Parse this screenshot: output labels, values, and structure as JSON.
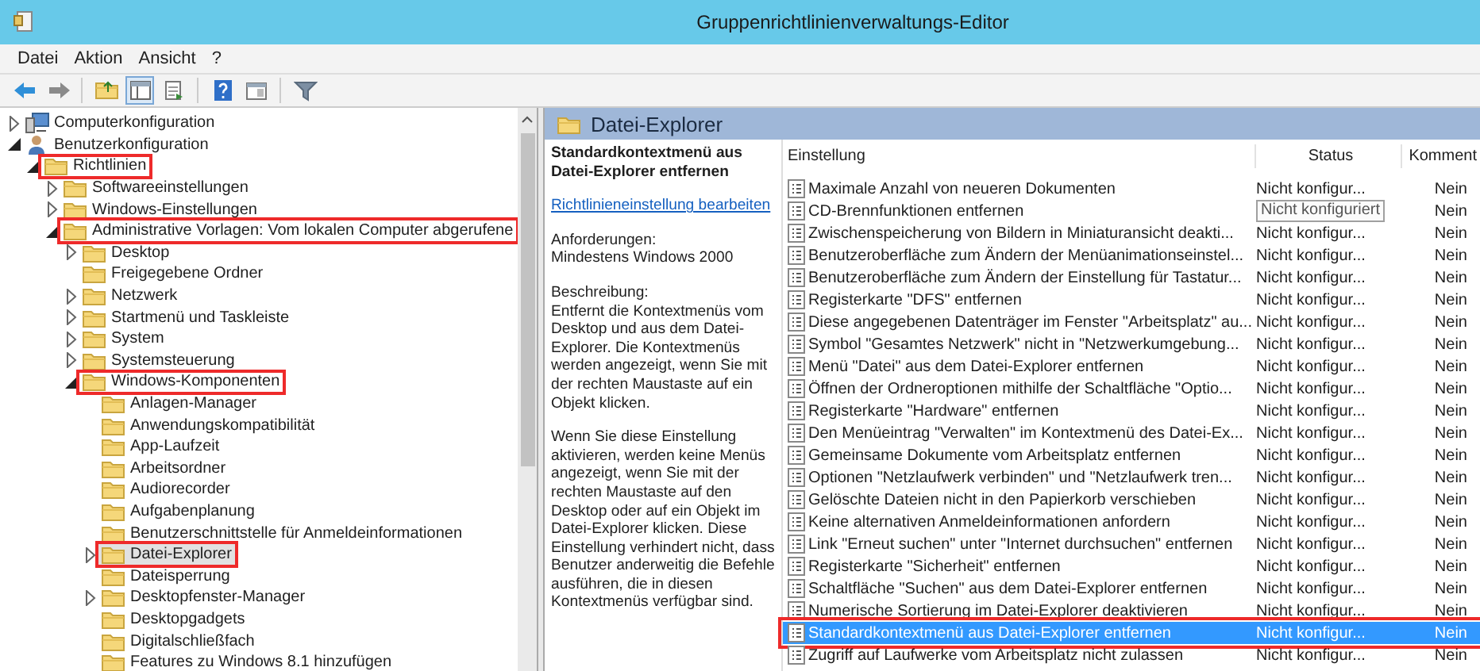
{
  "window": {
    "title": "Gruppenrichtlinienverwaltungs-Editor"
  },
  "menu": [
    "Datei",
    "Aktion",
    "Ansicht",
    "?"
  ],
  "tree": [
    {
      "label": "Computerkonfiguration",
      "kind": "computer",
      "expandable": true,
      "expanded": false,
      "selected": false,
      "highlighted": false
    },
    {
      "label": "Benutzerkonfiguration",
      "kind": "user",
      "expandable": true,
      "expanded": true,
      "selected": false,
      "highlighted": false,
      "children": [
        {
          "label": "Richtlinien",
          "kind": "folder",
          "expandable": true,
          "expanded": true,
          "selected": false,
          "highlighted": true,
          "children": [
            {
              "label": "Softwareeinstellungen",
              "kind": "folder",
              "expandable": true,
              "expanded": false,
              "selected": false,
              "highlighted": false
            },
            {
              "label": "Windows-Einstellungen",
              "kind": "folder",
              "expandable": true,
              "expanded": false,
              "selected": false,
              "highlighted": false
            },
            {
              "label": "Administrative Vorlagen: Vom lokalen Computer abgerufene",
              "kind": "folder",
              "expandable": true,
              "expanded": true,
              "selected": false,
              "highlighted": true,
              "children": [
                {
                  "label": "Desktop",
                  "kind": "folder",
                  "expandable": true,
                  "expanded": false,
                  "selected": false,
                  "highlighted": false
                },
                {
                  "label": "Freigegebene Ordner",
                  "kind": "folder",
                  "expandable": false,
                  "selected": false,
                  "highlighted": false
                },
                {
                  "label": "Netzwerk",
                  "kind": "folder",
                  "expandable": true,
                  "expanded": false,
                  "selected": false,
                  "highlighted": false
                },
                {
                  "label": "Startmenü und Taskleiste",
                  "kind": "folder",
                  "expandable": true,
                  "expanded": false,
                  "selected": false,
                  "highlighted": false
                },
                {
                  "label": "System",
                  "kind": "folder",
                  "expandable": true,
                  "expanded": false,
                  "selected": false,
                  "highlighted": false
                },
                {
                  "label": "Systemsteuerung",
                  "kind": "folder",
                  "expandable": true,
                  "expanded": false,
                  "selected": false,
                  "highlighted": false
                },
                {
                  "label": "Windows-Komponenten",
                  "kind": "folder",
                  "expandable": true,
                  "expanded": true,
                  "selected": false,
                  "highlighted": true,
                  "children": [
                    {
                      "label": "Anlagen-Manager",
                      "kind": "folder",
                      "expandable": false,
                      "selected": false,
                      "highlighted": false
                    },
                    {
                      "label": "Anwendungskompatibilität",
                      "kind": "folder",
                      "expandable": false,
                      "selected": false,
                      "highlighted": false
                    },
                    {
                      "label": "App-Laufzeit",
                      "kind": "folder",
                      "expandable": false,
                      "selected": false,
                      "highlighted": false
                    },
                    {
                      "label": "Arbeitsordner",
                      "kind": "folder",
                      "expandable": false,
                      "selected": false,
                      "highlighted": false
                    },
                    {
                      "label": "Audiorecorder",
                      "kind": "folder",
                      "expandable": false,
                      "selected": false,
                      "highlighted": false
                    },
                    {
                      "label": "Aufgabenplanung",
                      "kind": "folder",
                      "expandable": false,
                      "selected": false,
                      "highlighted": false
                    },
                    {
                      "label": "Benutzerschnittstelle für Anmeldeinformationen",
                      "kind": "folder",
                      "expandable": false,
                      "selected": false,
                      "highlighted": false
                    },
                    {
                      "label": "Datei-Explorer",
                      "kind": "folder",
                      "expandable": true,
                      "expanded": false,
                      "selected": true,
                      "highlighted": true
                    },
                    {
                      "label": "Dateisperrung",
                      "kind": "folder",
                      "expandable": false,
                      "selected": false,
                      "highlighted": false
                    },
                    {
                      "label": "Desktopfenster-Manager",
                      "kind": "folder",
                      "expandable": true,
                      "expanded": false,
                      "selected": false,
                      "highlighted": false
                    },
                    {
                      "label": "Desktopgadgets",
                      "kind": "folder",
                      "expandable": false,
                      "selected": false,
                      "highlighted": false
                    },
                    {
                      "label": "Digitalschließfach",
                      "kind": "folder",
                      "expandable": false,
                      "selected": false,
                      "highlighted": false
                    },
                    {
                      "label": "Features zu Windows 8.1 hinzufügen",
                      "kind": "folder",
                      "expandable": false,
                      "selected": false,
                      "highlighted": false
                    }
                  ]
                }
              ]
            }
          ]
        }
      ]
    }
  ],
  "details": {
    "header": "Datei-Explorer",
    "title": "Standardkontextmenü aus Datei-Explorer entfernen",
    "link": "Richtlinieneinstellung bearbeiten",
    "requirements_label": "Anforderungen:",
    "requirements": "Mindestens Windows 2000",
    "description_label": "Beschreibung:",
    "paragraphs": [
      "Entfernt die Kontextmenüs vom Desktop und aus dem Datei-Explorer. Die Kontextmenüs werden angezeigt, wenn Sie mit der rechten Maustaste auf ein Objekt klicken.",
      "Wenn Sie diese Einstellung aktivieren, werden keine Menüs angezeigt, wenn Sie mit der rechten Maustaste auf den Desktop oder auf ein Objekt im Datei-Explorer klicken. Diese Einstellung verhindert nicht, dass Benutzer anderweitig die Befehle ausführen, die in diesen Kontextmenüs verfügbar sind."
    ]
  },
  "table": {
    "columns": [
      "Einstellung",
      "Status",
      "Komment"
    ],
    "rows": [
      {
        "setting": "Maximale Anzahl von neueren Dokumenten",
        "status": "Nicht konfigur...",
        "comment": "Nein",
        "selected": false,
        "highlighted": false,
        "status_tooltip": false
      },
      {
        "setting": "CD-Brennfunktionen entfernen",
        "status": "Nicht konfiguriert",
        "comment": "Nein",
        "selected": false,
        "highlighted": false,
        "status_tooltip": true
      },
      {
        "setting": "Zwischenspeicherung von Bildern in Miniaturansicht deakti...",
        "status": "Nicht konfigur...",
        "comment": "Nein",
        "selected": false,
        "highlighted": false,
        "status_tooltip": false
      },
      {
        "setting": "Benutzeroberfläche zum Ändern der Menüanimationseinstel...",
        "status": "Nicht konfigur...",
        "comment": "Nein",
        "selected": false,
        "highlighted": false,
        "status_tooltip": false
      },
      {
        "setting": "Benutzeroberfläche zum Ändern der Einstellung für Tastatur...",
        "status": "Nicht konfigur...",
        "comment": "Nein",
        "selected": false,
        "highlighted": false,
        "status_tooltip": false
      },
      {
        "setting": "Registerkarte \"DFS\" entfernen",
        "status": "Nicht konfigur...",
        "comment": "Nein",
        "selected": false,
        "highlighted": false,
        "status_tooltip": false
      },
      {
        "setting": "Diese angegebenen Datenträger im Fenster \"Arbeitsplatz\" au...",
        "status": "Nicht konfigur...",
        "comment": "Nein",
        "selected": false,
        "highlighted": false,
        "status_tooltip": false
      },
      {
        "setting": "Symbol \"Gesamtes Netzwerk\" nicht in \"Netzwerkumgebung...",
        "status": "Nicht konfigur...",
        "comment": "Nein",
        "selected": false,
        "highlighted": false,
        "status_tooltip": false
      },
      {
        "setting": "Menü \"Datei\" aus dem Datei-Explorer entfernen",
        "status": "Nicht konfigur...",
        "comment": "Nein",
        "selected": false,
        "highlighted": false,
        "status_tooltip": false
      },
      {
        "setting": "Öffnen der Ordneroptionen mithilfe der Schaltfläche \"Optio...",
        "status": "Nicht konfigur...",
        "comment": "Nein",
        "selected": false,
        "highlighted": false,
        "status_tooltip": false
      },
      {
        "setting": "Registerkarte \"Hardware\" entfernen",
        "status": "Nicht konfigur...",
        "comment": "Nein",
        "selected": false,
        "highlighted": false,
        "status_tooltip": false
      },
      {
        "setting": "Den Menüeintrag \"Verwalten\" im Kontextmenü des Datei-Ex...",
        "status": "Nicht konfigur...",
        "comment": "Nein",
        "selected": false,
        "highlighted": false,
        "status_tooltip": false
      },
      {
        "setting": "Gemeinsame Dokumente vom Arbeitsplatz entfernen",
        "status": "Nicht konfigur...",
        "comment": "Nein",
        "selected": false,
        "highlighted": false,
        "status_tooltip": false
      },
      {
        "setting": "Optionen \"Netzlaufwerk verbinden\" und \"Netzlaufwerk tren...",
        "status": "Nicht konfigur...",
        "comment": "Nein",
        "selected": false,
        "highlighted": false,
        "status_tooltip": false
      },
      {
        "setting": "Gelöschte Dateien nicht in den Papierkorb verschieben",
        "status": "Nicht konfigur...",
        "comment": "Nein",
        "selected": false,
        "highlighted": false,
        "status_tooltip": false
      },
      {
        "setting": "Keine alternativen Anmeldeinformationen anfordern",
        "status": "Nicht konfigur...",
        "comment": "Nein",
        "selected": false,
        "highlighted": false,
        "status_tooltip": false
      },
      {
        "setting": "Link \"Erneut suchen\" unter \"Internet durchsuchen\" entfernen",
        "status": "Nicht konfigur...",
        "comment": "Nein",
        "selected": false,
        "highlighted": false,
        "status_tooltip": false
      },
      {
        "setting": "Registerkarte \"Sicherheit\" entfernen",
        "status": "Nicht konfigur...",
        "comment": "Nein",
        "selected": false,
        "highlighted": false,
        "status_tooltip": false
      },
      {
        "setting": "Schaltfläche \"Suchen\" aus dem Datei-Explorer entfernen",
        "status": "Nicht konfigur...",
        "comment": "Nein",
        "selected": false,
        "highlighted": false,
        "status_tooltip": false
      },
      {
        "setting": "Numerische Sortierung im Datei-Explorer deaktivieren",
        "status": "Nicht konfigur...",
        "comment": "Nein",
        "selected": false,
        "highlighted": false,
        "status_tooltip": false
      },
      {
        "setting": "Standardkontextmenü aus Datei-Explorer entfernen",
        "status": "Nicht konfigur...",
        "comment": "Nein",
        "selected": true,
        "highlighted": true,
        "status_tooltip": false
      },
      {
        "setting": "Zugriff auf Laufwerke vom Arbeitsplatz nicht zulassen",
        "status": "Nicht konfigur...",
        "comment": "Nein",
        "selected": false,
        "highlighted": false,
        "status_tooltip": false
      }
    ]
  }
}
